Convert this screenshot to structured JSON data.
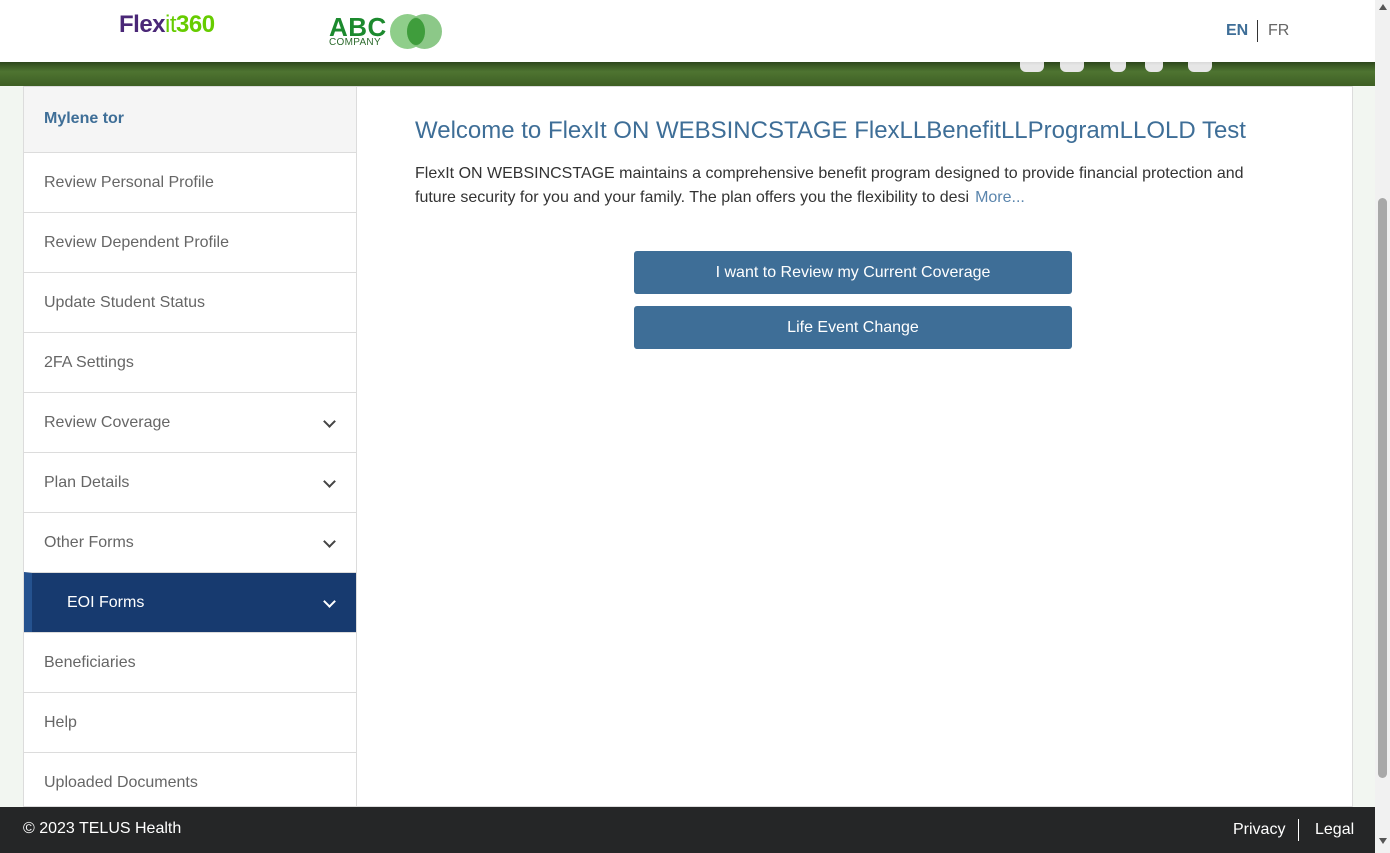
{
  "header": {
    "logo_flexit_part1": "Flex",
    "logo_flexit_part2": "it",
    "logo_flexit_part3": "360",
    "logo_abc": "ABC",
    "logo_company": "COMPANY",
    "lang_en": "EN",
    "lang_fr": "FR"
  },
  "sidebar": {
    "user_name": "Mylene tor",
    "items": [
      {
        "label": "Review Personal Profile"
      },
      {
        "label": "Review Dependent Profile"
      },
      {
        "label": "Update Student Status"
      },
      {
        "label": "2FA Settings"
      },
      {
        "label": "Review Coverage"
      },
      {
        "label": "Plan Details"
      },
      {
        "label": "Other Forms"
      },
      {
        "label": "EOI Forms"
      },
      {
        "label": "Beneficiaries"
      },
      {
        "label": "Help"
      },
      {
        "label": "Uploaded Documents"
      }
    ]
  },
  "main": {
    "welcome_title": "Welcome to FlexIt ON WEBSINCSTAGE FlexLLBenefitLLProgramLLOLD Test",
    "intro_text": "FlexIt ON WEBSINCSTAGE maintains a comprehensive benefit program designed to provide financial protection and future security for you and your family.  The plan offers you the flexibility to desi",
    "more_link": "More...",
    "review_coverage_button": "I want to Review my Current Coverage",
    "life_event_button": "Life Event Change"
  },
  "footer": {
    "copyright": "© 2023 TELUS Health",
    "privacy": "Privacy",
    "legal": "Legal"
  },
  "colors": {
    "accent": "#3e6e97",
    "active_nav": "#173a6f",
    "footer_bg": "#252627",
    "brand_purple": "#4a2777",
    "brand_green": "#66cc00"
  },
  "icons": {
    "expand": "chevron-down-icon",
    "scroll_up": "scroll-up-arrow-icon",
    "scroll_down": "scroll-down-arrow-icon"
  }
}
